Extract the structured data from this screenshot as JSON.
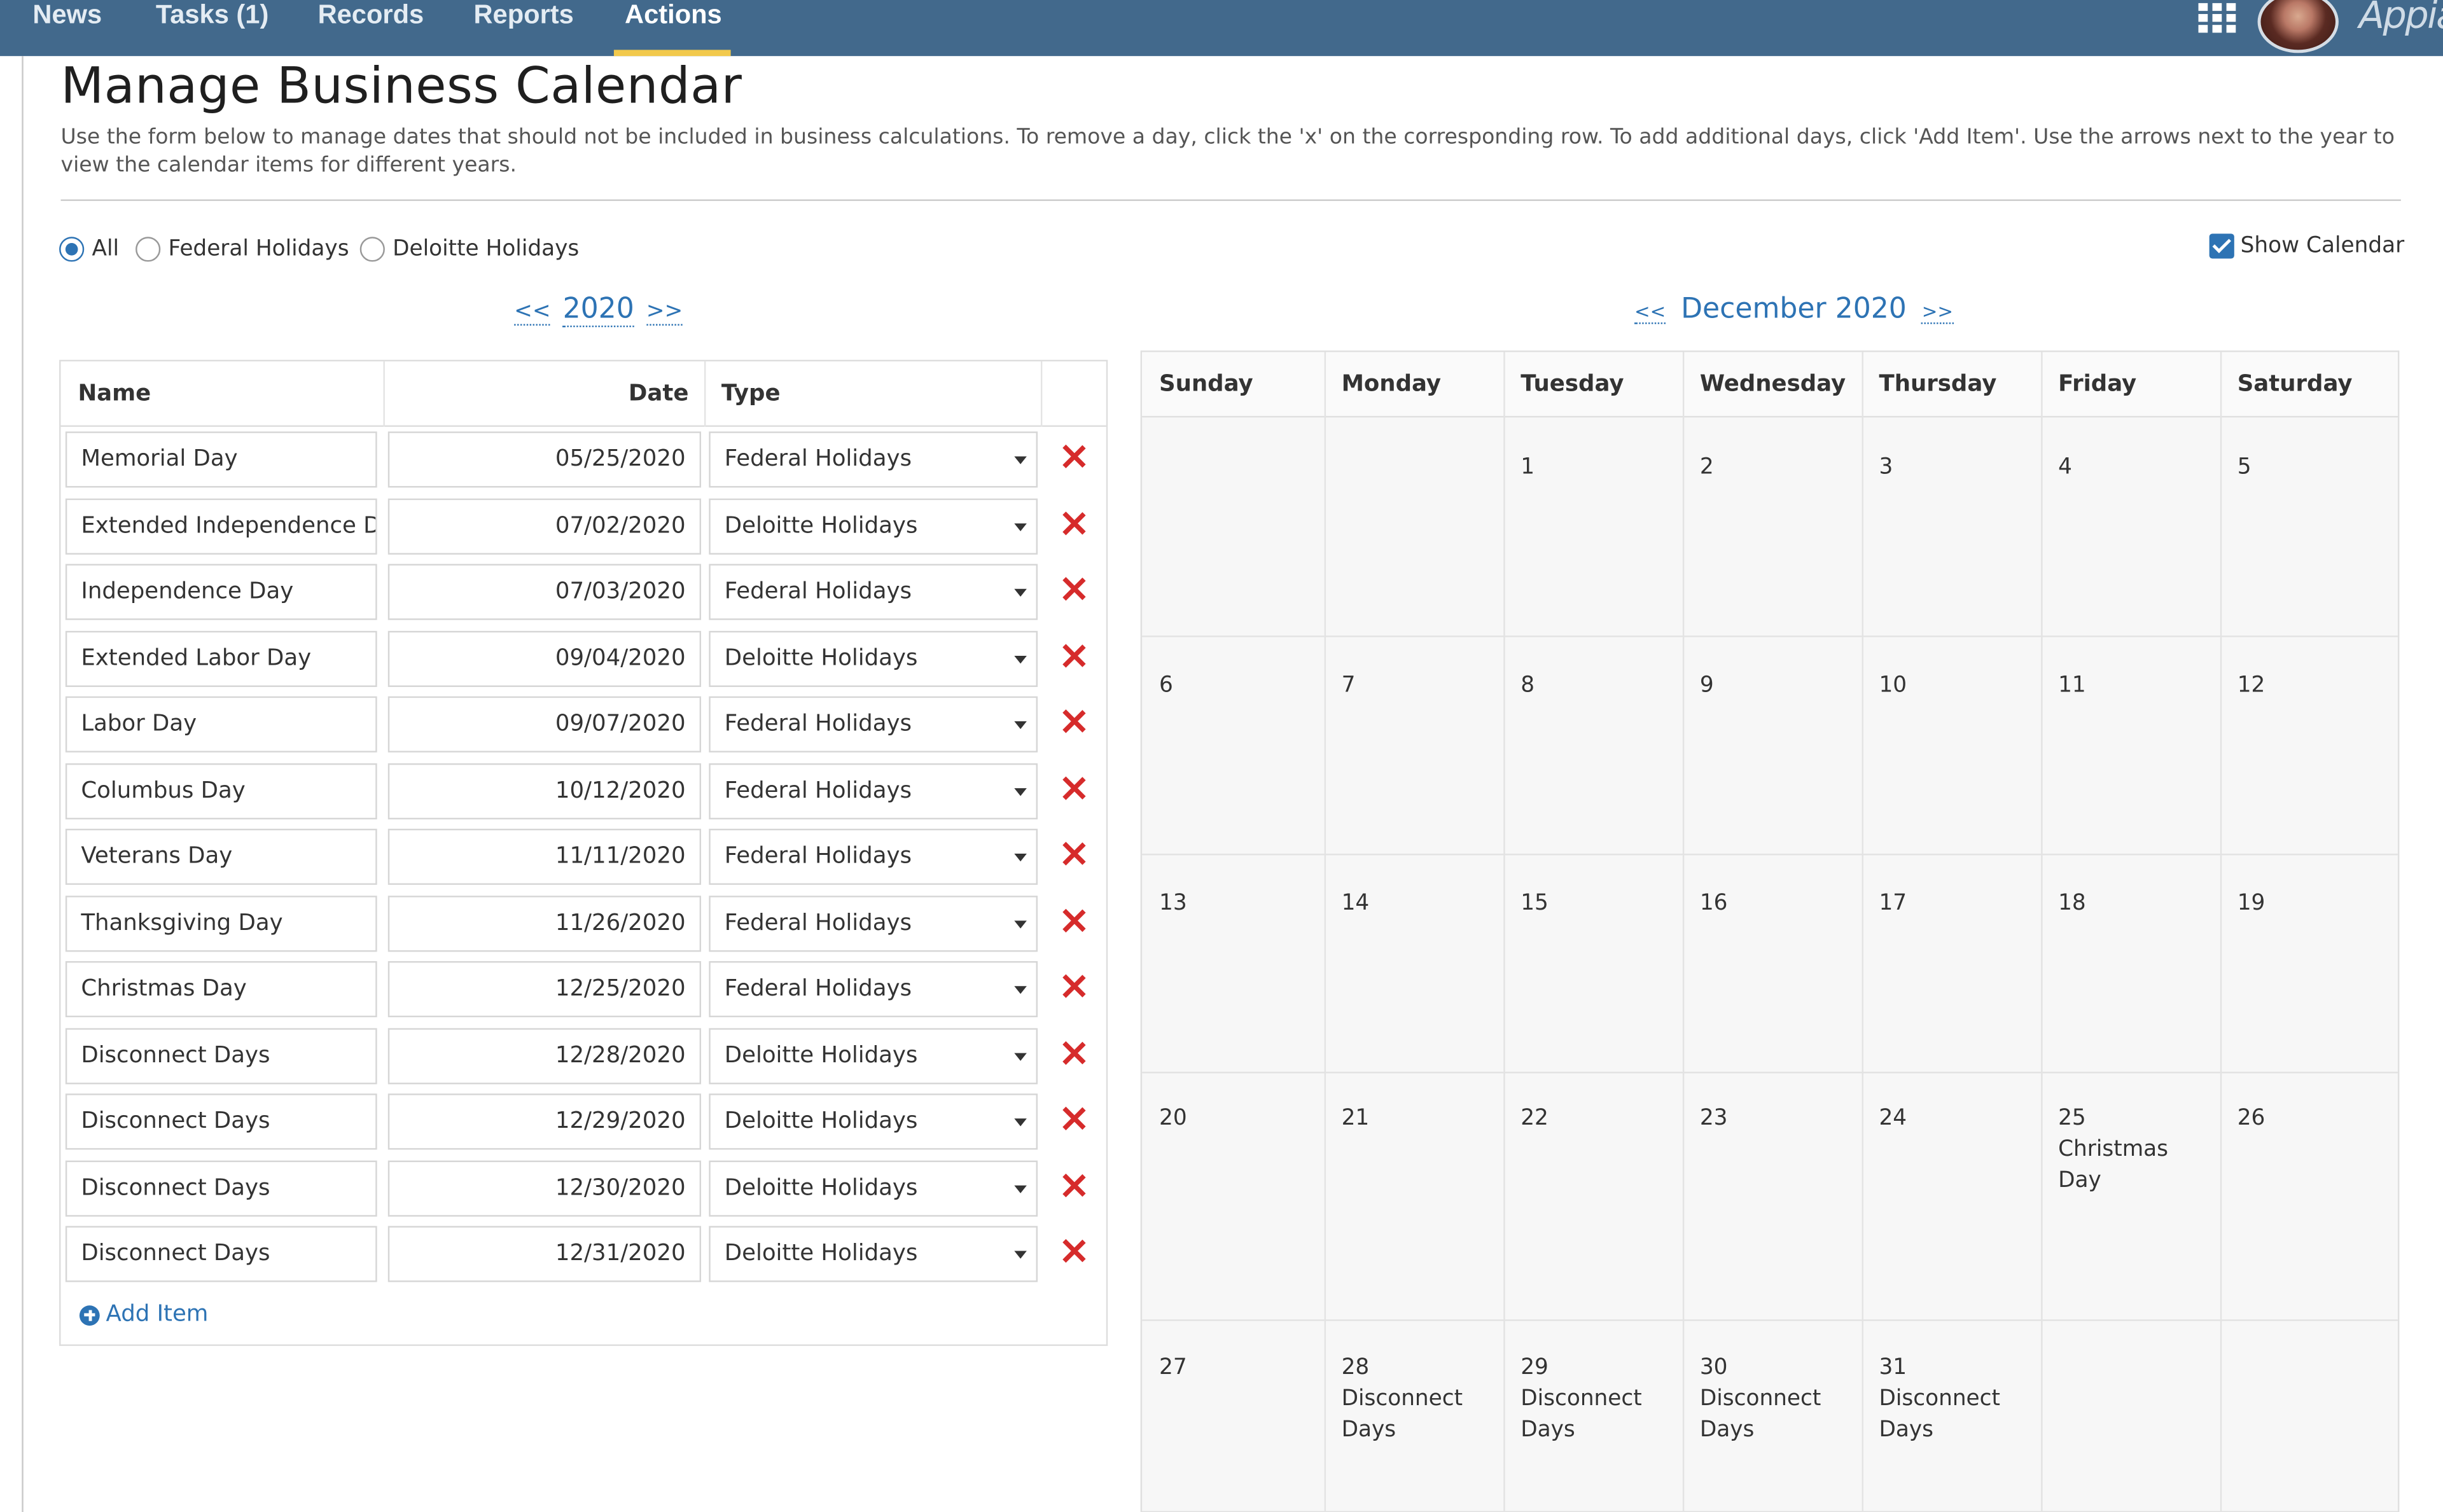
{
  "nav": {
    "tabs": [
      "News",
      "Tasks (1)",
      "Records",
      "Reports",
      "Actions"
    ],
    "active": "Actions",
    "brand": "Appian",
    "apps_icon": "grid-icon"
  },
  "page": {
    "title": "Manage Business Calendar",
    "instructions": "Use the form below to manage dates that should not be included in business calculations. To remove a day, click the 'x' on the corresponding row. To add additional days, click 'Add Item'. Use the arrows next to the year to view the calendar items for different years."
  },
  "filter": {
    "options": [
      "All",
      "Federal Holidays",
      "Deloitte Holidays"
    ],
    "selected": "All",
    "show_calendar_label": "Show Calendar",
    "show_calendar_checked": true
  },
  "year_nav": {
    "prev": "<<",
    "year": "2020",
    "next": ">>"
  },
  "month_nav": {
    "prev": "<<",
    "label": "December 2020",
    "next": ">>"
  },
  "grid": {
    "columns": [
      "Name",
      "Date",
      "Type"
    ],
    "rows": [
      {
        "name": "Memorial Day",
        "date": "05/25/2020",
        "type": "Federal Holidays"
      },
      {
        "name": "Extended Independence Da",
        "date": "07/02/2020",
        "type": "Deloitte Holidays"
      },
      {
        "name": "Independence Day",
        "date": "07/03/2020",
        "type": "Federal Holidays"
      },
      {
        "name": "Extended Labor Day",
        "date": "09/04/2020",
        "type": "Deloitte Holidays"
      },
      {
        "name": "Labor Day",
        "date": "09/07/2020",
        "type": "Federal Holidays"
      },
      {
        "name": "Columbus Day",
        "date": "10/12/2020",
        "type": "Federal Holidays"
      },
      {
        "name": "Veterans Day",
        "date": "11/11/2020",
        "type": "Federal Holidays"
      },
      {
        "name": "Thanksgiving Day",
        "date": "11/26/2020",
        "type": "Federal Holidays"
      },
      {
        "name": "Christmas Day",
        "date": "12/25/2020",
        "type": "Federal Holidays"
      },
      {
        "name": "Disconnect Days",
        "date": "12/28/2020",
        "type": "Deloitte Holidays"
      },
      {
        "name": "Disconnect Days",
        "date": "12/29/2020",
        "type": "Deloitte Holidays"
      },
      {
        "name": "Disconnect Days",
        "date": "12/30/2020",
        "type": "Deloitte Holidays"
      },
      {
        "name": "Disconnect Days",
        "date": "12/31/2020",
        "type": "Deloitte Holidays"
      }
    ],
    "add_item_label": "Add Item"
  },
  "calendar": {
    "weekdays": [
      "Sunday",
      "Monday",
      "Tuesday",
      "Wednesday",
      "Thursday",
      "Friday",
      "Saturday"
    ],
    "weeks": [
      [
        {
          "d": ""
        },
        {
          "d": ""
        },
        {
          "d": "1"
        },
        {
          "d": "2"
        },
        {
          "d": "3"
        },
        {
          "d": "4"
        },
        {
          "d": "5"
        }
      ],
      [
        {
          "d": "6"
        },
        {
          "d": "7"
        },
        {
          "d": "8"
        },
        {
          "d": "9"
        },
        {
          "d": "10"
        },
        {
          "d": "11"
        },
        {
          "d": "12"
        }
      ],
      [
        {
          "d": "13"
        },
        {
          "d": "14"
        },
        {
          "d": "15"
        },
        {
          "d": "16"
        },
        {
          "d": "17"
        },
        {
          "d": "18"
        },
        {
          "d": "19"
        }
      ],
      [
        {
          "d": "20"
        },
        {
          "d": "21"
        },
        {
          "d": "22"
        },
        {
          "d": "23"
        },
        {
          "d": "24"
        },
        {
          "d": "25",
          "e": [
            "Christmas",
            "Day"
          ]
        },
        {
          "d": "26"
        }
      ],
      [
        {
          "d": "27"
        },
        {
          "d": "28",
          "e": [
            "Disconnect",
            "Days"
          ]
        },
        {
          "d": "29",
          "e": [
            "Disconnect",
            "Days"
          ]
        },
        {
          "d": "30",
          "e": [
            "Disconnect",
            "Days"
          ]
        },
        {
          "d": "31",
          "e": [
            "Disconnect",
            "Days"
          ]
        },
        {
          "d": ""
        },
        {
          "d": ""
        }
      ]
    ]
  },
  "colors": {
    "nav_bg": "#42698c",
    "accent": "#2d73b4",
    "delete": "#d62b2b",
    "active_underline": "#f2c94c"
  }
}
